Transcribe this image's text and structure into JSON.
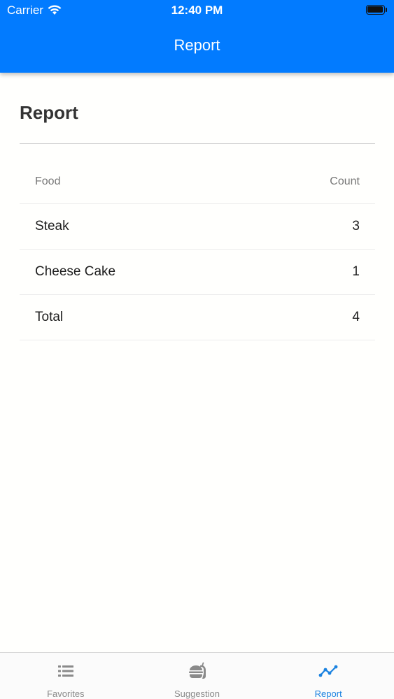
{
  "status_bar": {
    "carrier": "Carrier",
    "time": "12:40 PM"
  },
  "header": {
    "title": "Report"
  },
  "page": {
    "title": "Report"
  },
  "table": {
    "columns": [
      "Food",
      "Count"
    ],
    "rows": [
      {
        "food": "Steak",
        "count": "3"
      },
      {
        "food": "Cheese Cake",
        "count": "1"
      },
      {
        "food": "Total",
        "count": "4"
      }
    ]
  },
  "tabbar": {
    "items": [
      {
        "label": "Favorites",
        "icon": "list-icon"
      },
      {
        "label": "Suggestion",
        "icon": "food-icon"
      },
      {
        "label": "Report",
        "icon": "line-chart-icon",
        "active": true
      }
    ]
  },
  "colors": {
    "accent": "#027bff",
    "tab_active": "#1a82e0",
    "tab_inactive": "#8a8a8a"
  }
}
